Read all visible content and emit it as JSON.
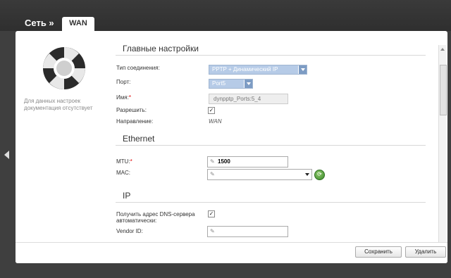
{
  "header": {
    "crumb": "Сеть »",
    "tab": "WAN"
  },
  "left": {
    "note": "Для данных настроек документация отсутствует"
  },
  "sections": {
    "main": {
      "title": "Главные настройки"
    },
    "ethernet": {
      "title": "Ethernet"
    },
    "ip": {
      "title": "IP"
    }
  },
  "fields": {
    "conn_type": {
      "label": "Тип соединения:",
      "value": "PPTP + Динамический IP"
    },
    "port": {
      "label": "Порт:",
      "value": "Port5"
    },
    "name": {
      "label": "Имя:",
      "required": "*",
      "value": "dynpptp_Ports:5_4"
    },
    "enable": {
      "label": "Разрешить:",
      "checked": "✓"
    },
    "direction": {
      "label": "Направление:",
      "value": "WAN"
    },
    "mtu": {
      "label": "MTU:",
      "required": "*",
      "value": "1500"
    },
    "mac": {
      "label": "MAC:",
      "value": ""
    },
    "dns_auto": {
      "label": "Получить адрес DNS-сервера автоматически:",
      "checked": "✓"
    },
    "vendor": {
      "label": "Vendor ID:",
      "value": ""
    }
  },
  "buttons": {
    "save": "Сохранить",
    "delete": "Удалить"
  },
  "icons": {
    "lifebuoy": "lifebuoy-icon",
    "pencil": "pencil-icon",
    "refresh": "refresh-icon",
    "back": "chevron-left-icon"
  }
}
